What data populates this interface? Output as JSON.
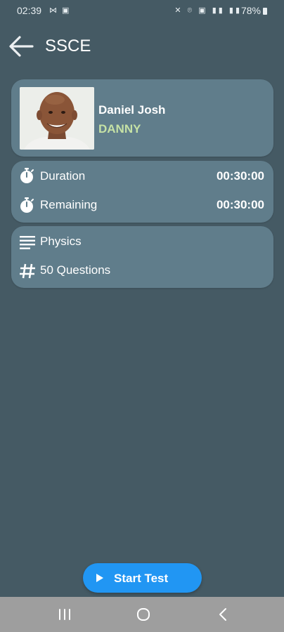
{
  "status_bar": {
    "time": "02:39",
    "left_icons": "⋈ ▣",
    "right_icons": "✕ ⌾ ▣ ▮▮ ▮▮",
    "battery": "78%"
  },
  "app_bar": {
    "title": "SSCE",
    "back_icon": "arrow-left-icon"
  },
  "profile": {
    "name": "Daniel Josh",
    "nickname": "DANNY",
    "nickname_color": "#c5e1a5"
  },
  "timer": {
    "duration_label": "Duration",
    "duration_value": "00:30:00",
    "remaining_label": "Remaining",
    "remaining_value": "00:30:00",
    "icon": "stopwatch-icon"
  },
  "subject": {
    "name": "Physics",
    "name_icon": "list-lines-icon",
    "questions": "50 Questions",
    "questions_icon": "hash-icon"
  },
  "actions": {
    "start_label": "Start Test",
    "start_icon": "play-icon",
    "start_color": "#2196f3"
  },
  "colors": {
    "background": "#455a64",
    "card": "#607d8b",
    "nav_bar": "#9e9e9e"
  }
}
